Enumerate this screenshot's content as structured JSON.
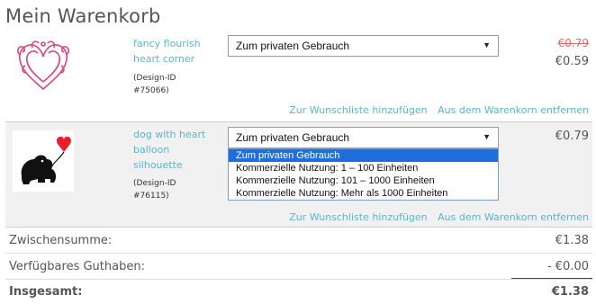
{
  "page": {
    "title": "Mein Warenkorb"
  },
  "cart": {
    "items": [
      {
        "name": "fancy flourish heart corner",
        "design_id": "(Design-ID #75066)",
        "license_selected": "Zum privaten Gebrauch",
        "old_price": "€0.79",
        "price": "€0.59",
        "wishlist_link": "Zur Wunschliste hinzufügen",
        "remove_link": "Aus dem Warenkorn entfernen"
      },
      {
        "name": "dog with heart balloon silhouette",
        "design_id": "(Design-ID #76115)",
        "license_selected": "Zum privaten Gebrauch",
        "license_options": [
          "Zum privaten Gebrauch",
          "Kommerzielle Nutzung: 1 – 100 Einheiten",
          "Kommerzielle Nutzung: 101 – 1000 Einheiten",
          "Kommerzielle Nutzung: Mehr als 1000 Einheiten"
        ],
        "price": "€0.79",
        "wishlist_link": "Zur Wunschliste hinzufügen",
        "remove_link": "Aus dem Warenkorn entfernen"
      }
    ]
  },
  "summary": {
    "subtotal_label": "Zwischensumme:",
    "subtotal_value": "€1.38",
    "credit_label": "Verfügbares Guthaben:",
    "credit_value": "- €0.00",
    "total_label": "Insgesamt:",
    "total_value": "€1.38"
  },
  "colors": {
    "link": "#5bb4cf",
    "strike_price": "#e06b6b",
    "highlight": "#1e6fd9",
    "heart_pink": "#e0447a",
    "balloon_red": "#e81f2a"
  },
  "icons": {
    "dropdown_arrow": "triangle-down-icon"
  }
}
